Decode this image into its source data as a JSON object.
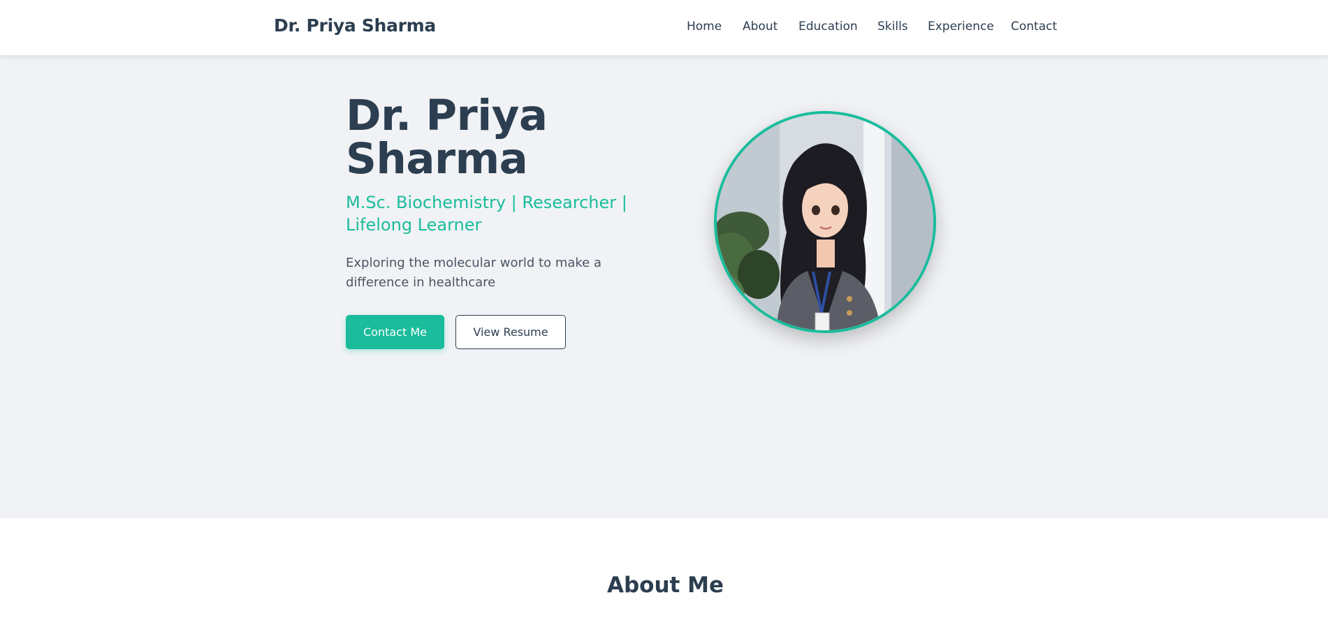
{
  "navbar": {
    "brand": "Dr. Priya Sharma",
    "links": [
      {
        "label": "Home"
      },
      {
        "label": "About"
      },
      {
        "label": "Education"
      },
      {
        "label": "Skills"
      },
      {
        "label": "Experience"
      },
      {
        "label": "Contact"
      }
    ]
  },
  "hero": {
    "title": "Dr. Priya Sharma",
    "subtitle": "M.Sc. Biochemistry | Researcher | Lifelong Learner",
    "tagline": "Exploring the molecular world to make a difference in healthcare",
    "primary_button": "Contact Me",
    "secondary_button": "View Resume"
  },
  "about": {
    "title": "About Me"
  },
  "colors": {
    "accent": "#1abc9c",
    "text_dark": "#2c3e50",
    "hero_bg": "#f0f2f5"
  }
}
